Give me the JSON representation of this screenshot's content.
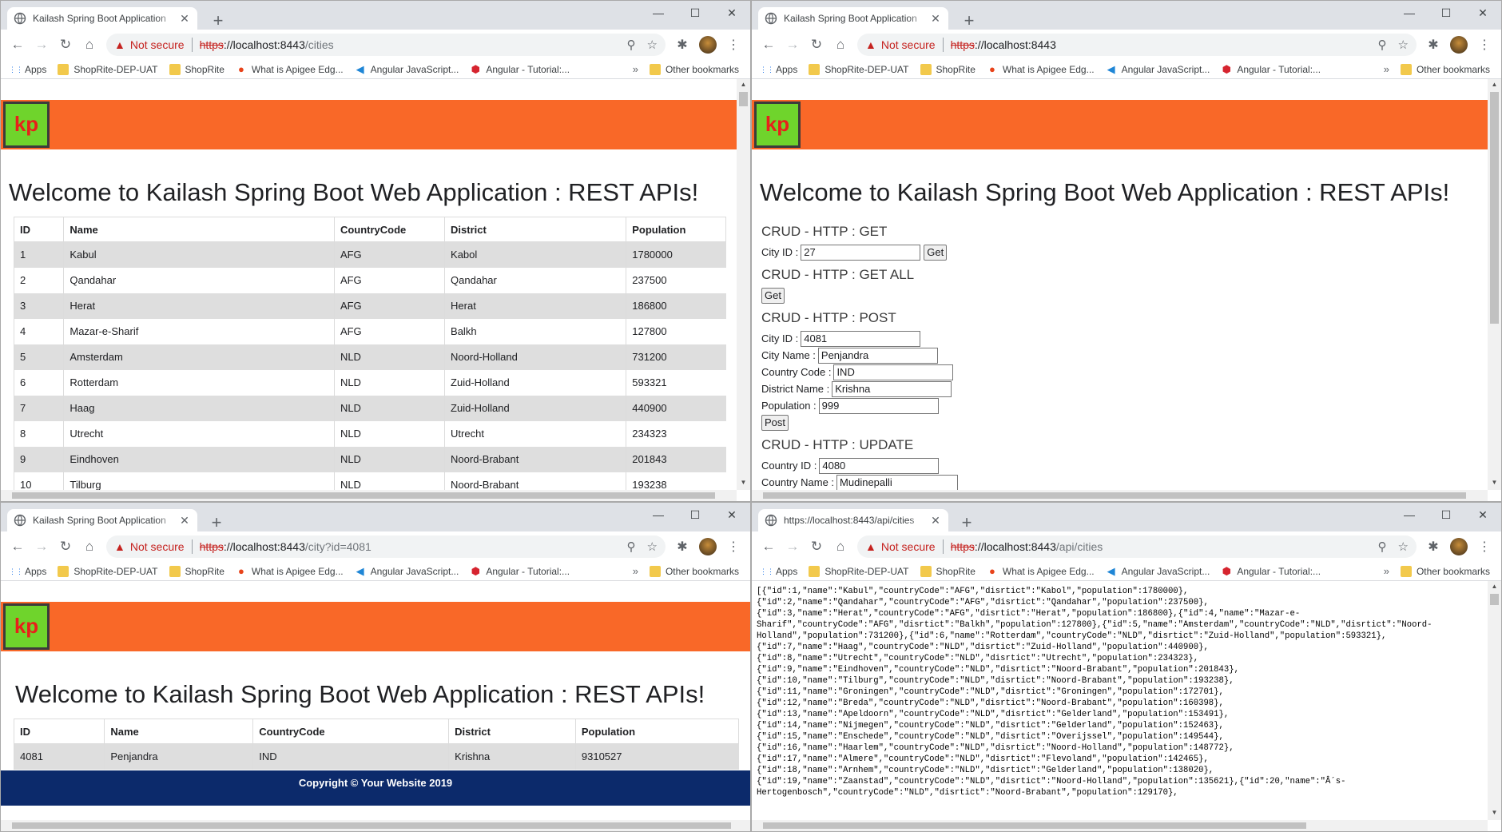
{
  "app_tab_title": "Kailash Spring Boot Application",
  "api_tab_title": "https://localhost:8443/api/cities",
  "security": {
    "label": "Not secure"
  },
  "window_controls": {
    "minimize": "—",
    "maximize": "☐",
    "close": "✕"
  },
  "bookmarks": [
    {
      "label": "Apps",
      "icon": "apps-icon"
    },
    {
      "label": "ShopRite-DEP-UAT",
      "icon": "folder-icon"
    },
    {
      "label": "ShopRite",
      "icon": "folder-icon"
    },
    {
      "label": "What is Apigee Edg...",
      "icon": "apigee-icon"
    },
    {
      "label": "Angular JavaScript...",
      "icon": "vscode-icon"
    },
    {
      "label": "Angular - Tutorial:...",
      "icon": "angular-icon"
    }
  ],
  "bookmarks_more": "»",
  "other_bookmarks": "Other bookmarks",
  "logo_text": "kp",
  "welcome": "Welcome to Kailash Spring Boot Web Application : REST APIs!",
  "windows": {
    "tl": {
      "url_scheme": "https",
      "url_host": "://localhost:8443",
      "url_path": "/cities"
    },
    "tr": {
      "url_scheme": "https",
      "url_host": "://localhost:8443",
      "url_path": ""
    },
    "bl": {
      "url_scheme": "https",
      "url_host": "://localhost:8443",
      "url_path": "/city?id=4081"
    },
    "br": {
      "url_scheme": "https",
      "url_host": "://localhost:8443",
      "url_path": "/api/cities"
    }
  },
  "city_table": {
    "columns": [
      "ID",
      "Name",
      "CountryCode",
      "District",
      "Population"
    ],
    "rows": [
      [
        "1",
        "Kabul",
        "AFG",
        "Kabol",
        "1780000"
      ],
      [
        "2",
        "Qandahar",
        "AFG",
        "Qandahar",
        "237500"
      ],
      [
        "3",
        "Herat",
        "AFG",
        "Herat",
        "186800"
      ],
      [
        "4",
        "Mazar-e-Sharif",
        "AFG",
        "Balkh",
        "127800"
      ],
      [
        "5",
        "Amsterdam",
        "NLD",
        "Noord-Holland",
        "731200"
      ],
      [
        "6",
        "Rotterdam",
        "NLD",
        "Zuid-Holland",
        "593321"
      ],
      [
        "7",
        "Haag",
        "NLD",
        "Zuid-Holland",
        "440900"
      ],
      [
        "8",
        "Utrecht",
        "NLD",
        "Utrecht",
        "234323"
      ],
      [
        "9",
        "Eindhoven",
        "NLD",
        "Noord-Brabant",
        "201843"
      ],
      [
        "10",
        "Tilburg",
        "NLD",
        "Noord-Brabant",
        "193238"
      ]
    ]
  },
  "single_city": {
    "columns": [
      "ID",
      "Name",
      "CountryCode",
      "District",
      "Population"
    ],
    "row": [
      "4081",
      "Penjandra",
      "IND",
      "Krishna",
      "9310527"
    ]
  },
  "footer": "Copyright © Your Website 2019",
  "crud": {
    "get": {
      "heading": "CRUD - HTTP : GET",
      "label": "City ID :",
      "value": "27",
      "button": "Get"
    },
    "get_all": {
      "heading": "CRUD - HTTP : GET ALL",
      "button": "Get"
    },
    "post": {
      "heading": "CRUD - HTTP : POST",
      "fields": [
        {
          "label": "City ID :",
          "value": "4081"
        },
        {
          "label": "City Name :",
          "value": "Penjandra"
        },
        {
          "label": "Country Code :",
          "value": "IND"
        },
        {
          "label": "District Name :",
          "value": "Krishna"
        },
        {
          "label": "Population :",
          "value": "999"
        }
      ],
      "button": "Post"
    },
    "update": {
      "heading": "CRUD - HTTP : UPDATE",
      "fields": [
        {
          "label": "Country ID :",
          "value": "4080"
        },
        {
          "label": "Country Name :",
          "value": "Mudinepalli"
        }
      ]
    }
  },
  "json_text": "[{\"id\":1,\"name\":\"Kabul\",\"countryCode\":\"AFG\",\"disrtict\":\"Kabol\",\"population\":1780000},\n{\"id\":2,\"name\":\"Qandahar\",\"countryCode\":\"AFG\",\"disrtict\":\"Qandahar\",\"population\":237500},\n{\"id\":3,\"name\":\"Herat\",\"countryCode\":\"AFG\",\"disrtict\":\"Herat\",\"population\":186800},{\"id\":4,\"name\":\"Mazar-e-\nSharif\",\"countryCode\":\"AFG\",\"disrtict\":\"Balkh\",\"population\":127800},{\"id\":5,\"name\":\"Amsterdam\",\"countryCode\":\"NLD\",\"disrtict\":\"Noord-\nHolland\",\"population\":731200},{\"id\":6,\"name\":\"Rotterdam\",\"countryCode\":\"NLD\",\"disrtict\":\"Zuid-Holland\",\"population\":593321},\n{\"id\":7,\"name\":\"Haag\",\"countryCode\":\"NLD\",\"disrtict\":\"Zuid-Holland\",\"population\":440900},\n{\"id\":8,\"name\":\"Utrecht\",\"countryCode\":\"NLD\",\"disrtict\":\"Utrecht\",\"population\":234323},\n{\"id\":9,\"name\":\"Eindhoven\",\"countryCode\":\"NLD\",\"disrtict\":\"Noord-Brabant\",\"population\":201843},\n{\"id\":10,\"name\":\"Tilburg\",\"countryCode\":\"NLD\",\"disrtict\":\"Noord-Brabant\",\"population\":193238},\n{\"id\":11,\"name\":\"Groningen\",\"countryCode\":\"NLD\",\"disrtict\":\"Groningen\",\"population\":172701},\n{\"id\":12,\"name\":\"Breda\",\"countryCode\":\"NLD\",\"disrtict\":\"Noord-Brabant\",\"population\":160398},\n{\"id\":13,\"name\":\"Apeldoorn\",\"countryCode\":\"NLD\",\"disrtict\":\"Gelderland\",\"population\":153491},\n{\"id\":14,\"name\":\"Nijmegen\",\"countryCode\":\"NLD\",\"disrtict\":\"Gelderland\",\"population\":152463},\n{\"id\":15,\"name\":\"Enschede\",\"countryCode\":\"NLD\",\"disrtict\":\"Overijssel\",\"population\":149544},\n{\"id\":16,\"name\":\"Haarlem\",\"countryCode\":\"NLD\",\"disrtict\":\"Noord-Holland\",\"population\":148772},\n{\"id\":17,\"name\":\"Almere\",\"countryCode\":\"NLD\",\"disrtict\":\"Flevoland\",\"population\":142465},\n{\"id\":18,\"name\":\"Arnhem\",\"countryCode\":\"NLD\",\"disrtict\":\"Gelderland\",\"population\":138020},\n{\"id\":19,\"name\":\"Zaanstad\",\"countryCode\":\"NLD\",\"disrtict\":\"Noord-Holland\",\"population\":135621},{\"id\":20,\"name\":\"Â´s-\nHertogenbosch\",\"countryCode\":\"NLD\",\"disrtict\":\"Noord-Brabant\",\"population\":129170},"
}
